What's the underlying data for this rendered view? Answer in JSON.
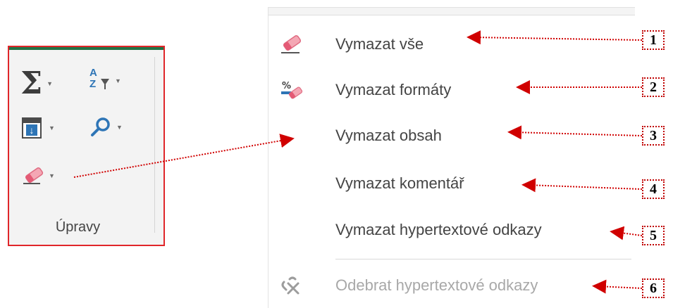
{
  "ribbon": {
    "group_label": "Úpravy",
    "buttons": [
      {
        "icon": "autosum-icon"
      },
      {
        "icon": "sort-filter-icon"
      },
      {
        "icon": "fill-icon"
      },
      {
        "icon": "find-select-icon"
      },
      {
        "icon": "eraser-icon"
      }
    ]
  },
  "menu": {
    "items": [
      {
        "label": "Vymazat vše",
        "icon": "eraser-icon",
        "disabled": false
      },
      {
        "label": "Vymazat formáty",
        "icon": "clear-formats-icon",
        "disabled": false
      },
      {
        "label": "Vymazat obsah",
        "icon": "",
        "disabled": false
      },
      {
        "label": "Vymazat komentář",
        "icon": "",
        "disabled": false
      },
      {
        "label": "Vymazat hypertextové odkazy",
        "icon": "",
        "disabled": false
      },
      {
        "label": "Odebrat hypertextové odkazy",
        "icon": "remove-hyperlink-icon",
        "disabled": true
      }
    ]
  },
  "callouts": [
    "1",
    "2",
    "3",
    "4",
    "5",
    "6"
  ],
  "colors": {
    "border": "#e0262a",
    "callout": "#c00000",
    "accent": "#217346"
  }
}
